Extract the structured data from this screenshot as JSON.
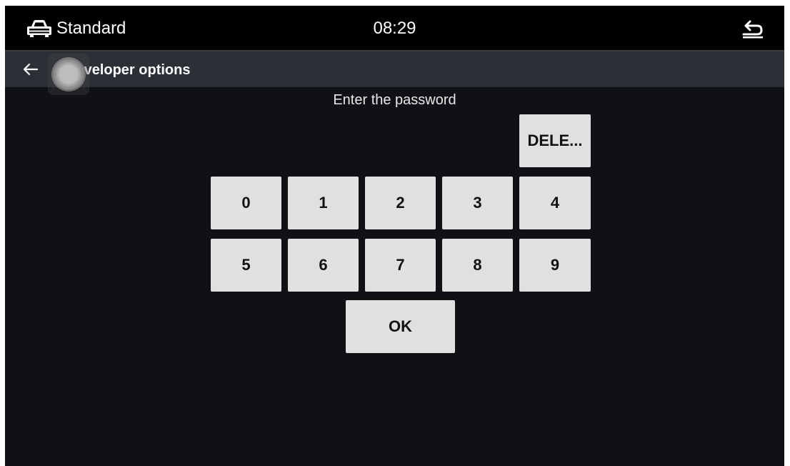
{
  "status_bar": {
    "mode_label": "Standard",
    "time": "08:29",
    "car_icon": "car-icon",
    "back_icon": "return-arrow-icon"
  },
  "header": {
    "title": "Developer options",
    "back_icon": "arrow-left-icon"
  },
  "prompt": "Enter the password",
  "keypad": {
    "delete_label": "DELE...",
    "row1": [
      "0",
      "1",
      "2",
      "3",
      "4"
    ],
    "row2": [
      "5",
      "6",
      "7",
      "8",
      "9"
    ],
    "ok_label": "OK"
  },
  "colors": {
    "background": "#0f1115",
    "status_bar": "#000000",
    "header_bar": "#2b3037",
    "key_bg": "#e0e0e0",
    "key_text": "#111111"
  }
}
